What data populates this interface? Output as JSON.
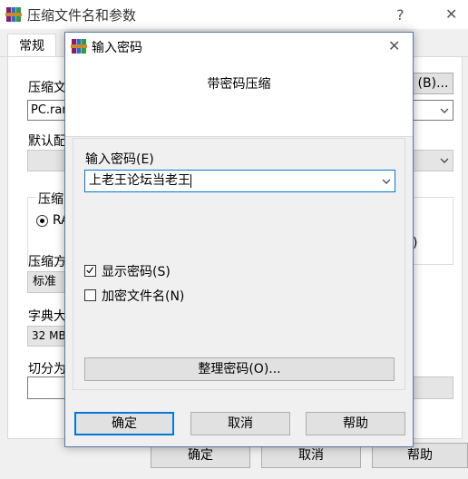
{
  "main_window": {
    "title": "压缩文件名和参数",
    "help_glyph": "?",
    "close_glyph": "✕",
    "tab_general": "常规",
    "archive_name_label": "压缩文",
    "browse_button": "(B)...",
    "archive_name_value": "PC.rar",
    "default_config_label": "默认配",
    "format_group_label": "压缩",
    "format_rar_label": "RA",
    "format_right_partial": ")",
    "method_label": "压缩方",
    "method_value": "标准",
    "dict_label": "字典大",
    "dict_value": "32 MB",
    "split_label": "切分为",
    "ok_button": "确定",
    "cancel_button": "取消",
    "help_button": "帮助"
  },
  "dialog": {
    "title": "输入密码",
    "close_glyph": "✕",
    "heading": "带密码压缩",
    "password_label": "输入密码(E)",
    "password_value": "上老王论坛当老王",
    "show_password_label": "显示密码(S)",
    "show_password_checked": true,
    "encrypt_names_label": "加密文件名(N)",
    "encrypt_names_checked": false,
    "organize_button": "整理密码(O)...",
    "ok_button": "确定",
    "cancel_button": "取消",
    "help_button": "帮助"
  },
  "icons": {
    "app": "winrar-books-icon"
  },
  "colors": {
    "focus_border": "#0078d7",
    "dialog_border": "#5a7aa8"
  }
}
